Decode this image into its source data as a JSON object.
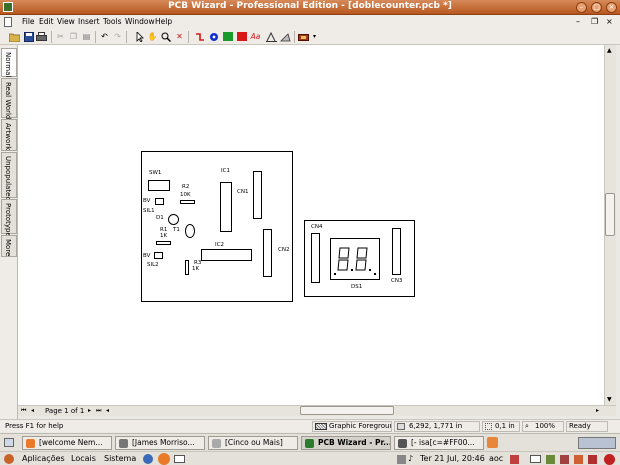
{
  "window": {
    "title": "PCB Wizard - Professional Edition - [doblecounter.pcb *]"
  },
  "menu": [
    "File",
    "Edit",
    "View",
    "Insert",
    "Tools",
    "Window",
    "Help"
  ],
  "side_tabs": [
    "Normal",
    "Real World",
    "Artwork",
    "Unpopulated",
    "Prototype",
    "More"
  ],
  "pcb": {
    "board1_labels": {
      "sw1": "SW1",
      "r2": "R2",
      "r2v": "10K",
      "ic1": "IC1",
      "cn1": "CN1",
      "bv1": "BV",
      "sil1": "SIL1",
      "d1": "D1",
      "r1": "R1",
      "r1v": "1K",
      "t1": "T1",
      "ic2": "IC2",
      "bv2": "BV",
      "sil2": "SIL2",
      "r3": "R3",
      "r3v": "1K",
      "cn2": "CN2"
    },
    "board2_labels": {
      "cn4": "CN4",
      "ds1": "DS1",
      "cn3": "CN3"
    }
  },
  "page_nav": {
    "label": "Page 1 of 1"
  },
  "status": {
    "help": "Press F1 for help",
    "layer": "Graphic Foreground",
    "coords": "6,292, 1,771 in",
    "grid": "0,1 in",
    "zoom": "100%",
    "state": "Ready"
  },
  "taskbar": [
    "[welcome Nem...",
    "[James Morriso...",
    "[Cinco ou Mais]",
    "PCB Wizard - Pr...",
    "[- isa[c=#FF00..."
  ],
  "panel": {
    "apps": "Aplicações",
    "places": "Locais",
    "system": "Sistema",
    "clock": "Ter 21 Jul, 20:46",
    "user": "aoc"
  },
  "colors": {
    "titlebar": "#c8632a",
    "green_tool": "#1a9a2a",
    "red_tool": "#d81818",
    "blue_tool": "#1030d0"
  }
}
